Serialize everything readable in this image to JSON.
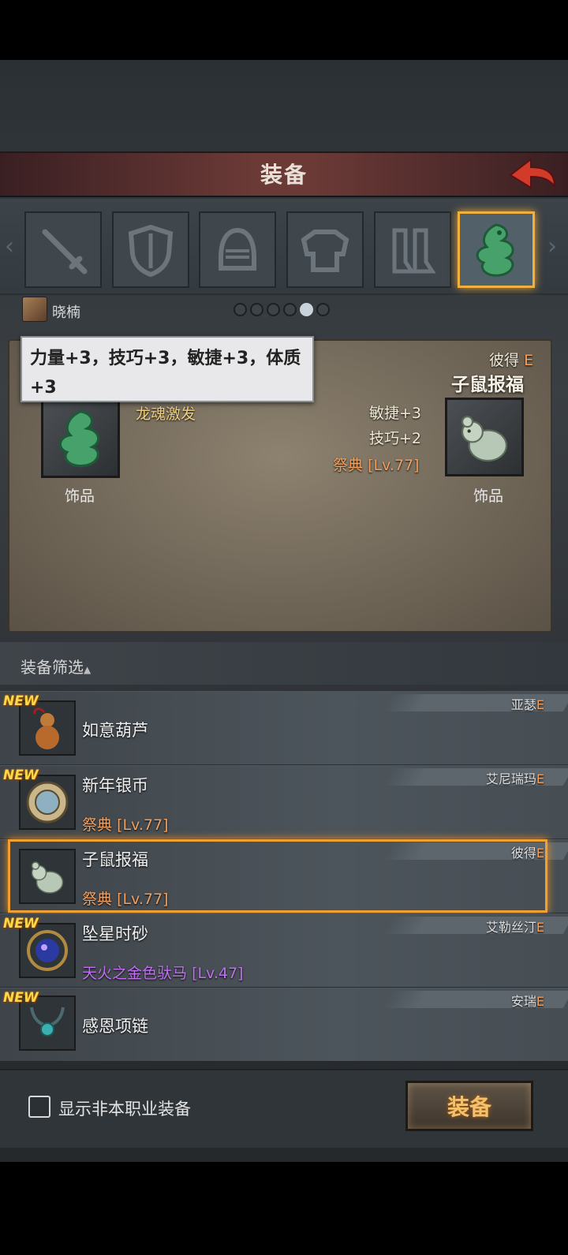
{
  "header": {
    "title": "装备"
  },
  "slots": [
    "sword-icon",
    "shield-icon",
    "helmet-icon",
    "armor-icon",
    "boots-icon",
    "dragon-jade-icon"
  ],
  "character": {
    "name": "晓楠"
  },
  "tooltip": {
    "text": "力量+3，技巧+3，敏捷+3，体质+3"
  },
  "compare": {
    "current": {
      "name": "龙魂激发",
      "type": "饰品"
    },
    "candidate": {
      "owner": "彼得",
      "owner_rank": "E",
      "name": "子鼠报福",
      "type": "饰品",
      "stats": [
        "敏捷+3",
        "技巧+2"
      ],
      "set_name": "祭典",
      "set_level": "[Lv.77]"
    }
  },
  "filter": {
    "label": "装备筛选"
  },
  "list": [
    {
      "new": "NEW",
      "name": "如意葫芦",
      "owner": "亚瑟",
      "rank": "E",
      "sub": "",
      "sub_level": ""
    },
    {
      "new": "NEW",
      "name": "新年银币",
      "owner": "艾尼瑞玛",
      "rank": "E",
      "sub": "祭典",
      "sub_level": "[Lv.77]"
    },
    {
      "new": "",
      "name": "子鼠报福",
      "owner": "彼得",
      "rank": "E",
      "sub": "祭典",
      "sub_level": "[Lv.77]"
    },
    {
      "new": "NEW",
      "name": "坠星时砂",
      "owner": "艾勒丝汀",
      "rank": "E",
      "sub": "天火之金色驮马",
      "sub_level": "[Lv.47]"
    },
    {
      "new": "NEW",
      "name": "感恩项链",
      "owner": "安瑞",
      "rank": "E",
      "sub": "",
      "sub_level": ""
    }
  ],
  "footer": {
    "checkbox_label": "显示非本职业装备",
    "equip_label": "装备"
  },
  "colors": {
    "accent": "#f0a030",
    "set_orange": "#f0a060",
    "set_purple": "#c070f0",
    "new_tag": "#ffd84a"
  }
}
